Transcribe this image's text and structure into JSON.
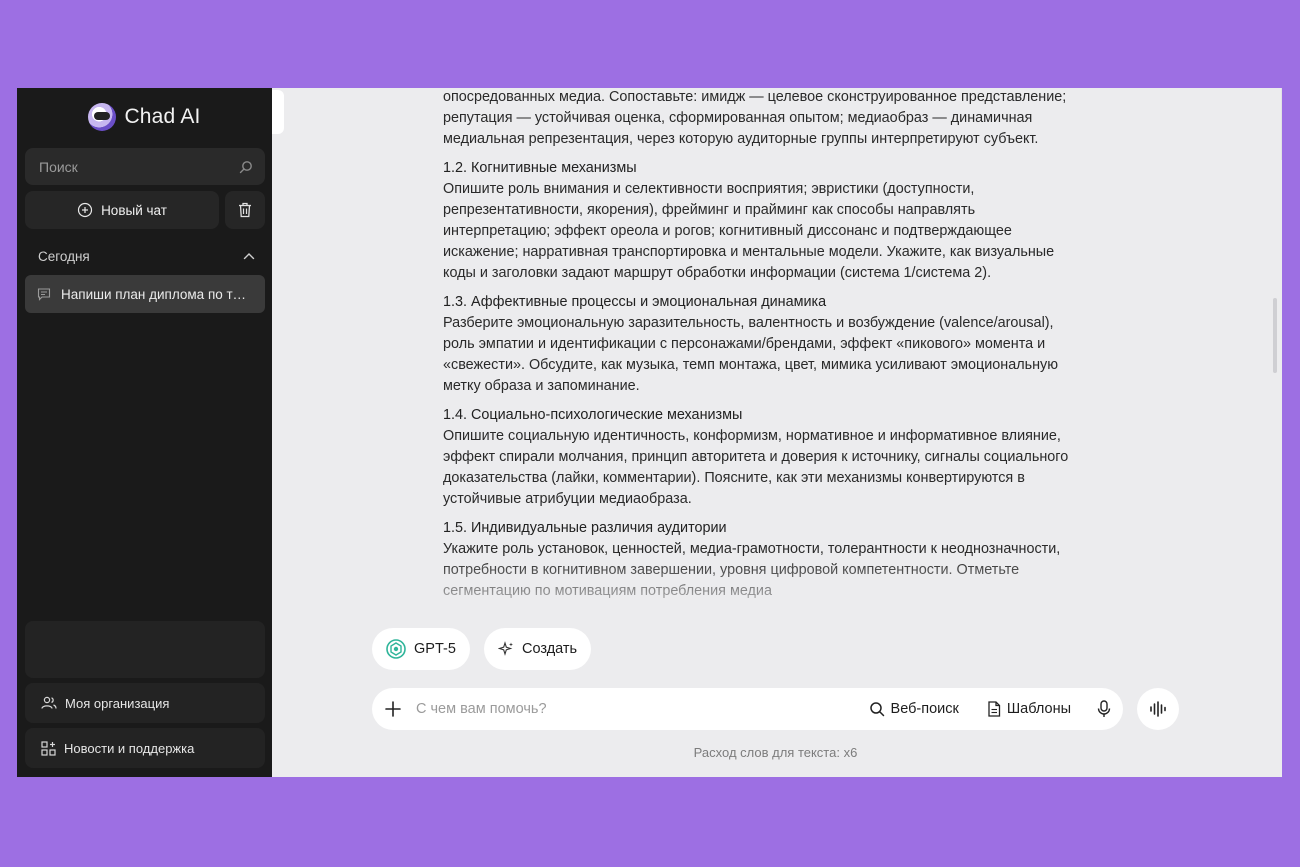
{
  "app": {
    "title": "Chad AI"
  },
  "sidebar": {
    "search_placeholder": "Поиск",
    "new_chat_label": "Новый чат",
    "section_today": "Сегодня",
    "chats": [
      {
        "label": "Напиши план диплома по тем..."
      }
    ],
    "links": [
      {
        "label": "Моя организация",
        "icon": "users-icon"
      },
      {
        "label": "Новости и поддержка",
        "icon": "grid-plus-icon"
      }
    ]
  },
  "content": {
    "intro": "опосредованных медиа. Сопоставьте: имидж — целевое сконструированное представление; репутация — устойчивая оценка, сформированная опытом; медиаобраз — динамичная медиальная репрезентация, через которую аудиторные группы интерпретируют субъект.",
    "sections": [
      {
        "heading": "1.2. Когнитивные механизмы",
        "body": "Опишите роль внимания и селективности восприятия; эвристики (доступности, репрезентативности, якорения), фрейминг и прайминг как способы направлять интерпретацию; эффект ореола и рогов; когнитивный диссонанс и подтверждающее искажение; нарративная транспортировка и ментальные модели. Укажите, как визуальные коды и заголовки задают маршрут обработки информации (система 1/система 2)."
      },
      {
        "heading": "1.3. Аффективные процессы и эмоциональная динамика",
        "body": "Разберите эмоциональную заразительность, валентность и возбуждение (valence/arousal), роль эмпатии и идентификации с персонажами/брендами, эффект «пикового» момента и «свежести». Обсудите, как музыка, темп монтажа, цвет, мимика усиливают эмоциональную метку образа и запоминание."
      },
      {
        "heading": "1.4. Социально-психологические механизмы",
        "body": "Опишите социальную идентичность, конформизм, нормативное и информативное влияние, эффект спирали молчания, принцип авторитета и доверия к источнику, сигналы социального доказательства (лайки, комментарии). Поясните, как эти механизмы конвертируются в устойчивые атрибуции медиаобраза."
      },
      {
        "heading": "1.5. Индивидуальные различия аудитории",
        "body": "Укажите роль установок, ценностей, медиа-грамотности, толерантности к неоднозначности, потребности в когнитивном завершении, уровня цифровой компетентности. Отметьте сегментацию по мотивациям потребления медиа"
      }
    ]
  },
  "composer": {
    "model_chip": "GPT-5",
    "create_chip": "Создать",
    "placeholder": "С чем вам помочь?",
    "web_search": "Веб-поиск",
    "templates": "Шаблоны",
    "footnote": "Расход слов для текста: x6"
  },
  "colors": {
    "accent_model": "#2fb59a",
    "sidebar_bg": "#1a1a1a",
    "page_bg": "#9d6fe3"
  }
}
